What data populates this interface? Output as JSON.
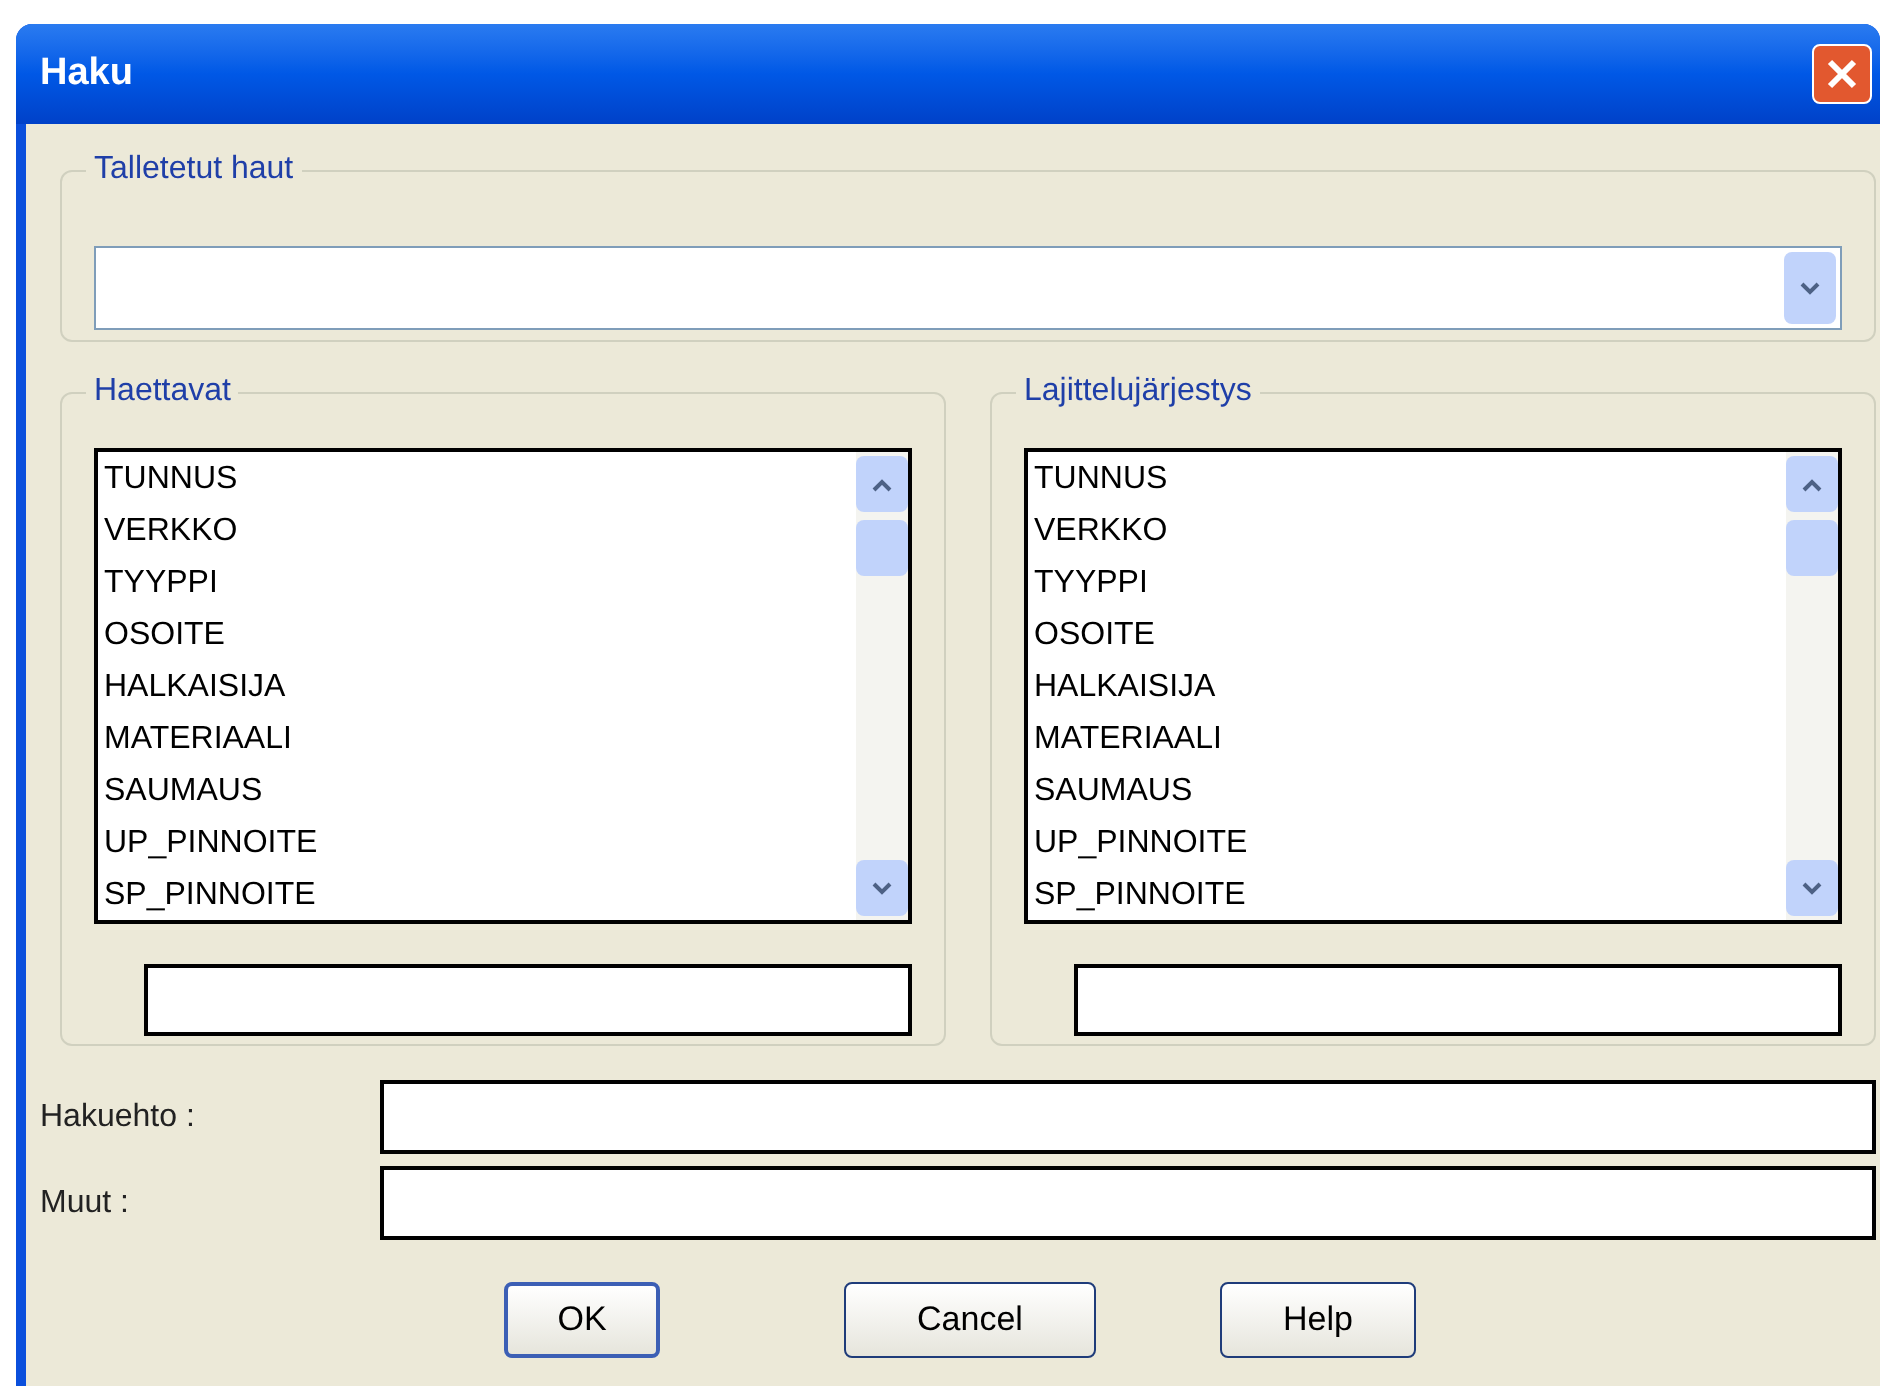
{
  "window": {
    "title": "Haku"
  },
  "saved_searches": {
    "label": "Talletetut haut"
  },
  "lists": [
    {
      "label": "Haettavat",
      "items": [
        "TUNNUS",
        "VERKKO",
        "TYYPPI",
        "OSOITE",
        "HALKAISIJA",
        "MATERIAALI",
        "SAUMAUS",
        "UP_PINNOITE",
        "SP_PINNOITE"
      ]
    },
    {
      "label": "Lajittelujärjestys",
      "items": [
        "TUNNUS",
        "VERKKO",
        "TYYPPI",
        "OSOITE",
        "HALKAISIJA",
        "MATERIAALI",
        "SAUMAUS",
        "UP_PINNOITE",
        "SP_PINNOITE"
      ]
    }
  ],
  "fields": [
    {
      "label": "Hakuehto :"
    },
    {
      "label": "Muut :"
    }
  ],
  "buttons": [
    {
      "label": "OK",
      "default": true
    },
    {
      "label": "Cancel",
      "default": false
    },
    {
      "label": "Help",
      "default": false
    }
  ]
}
